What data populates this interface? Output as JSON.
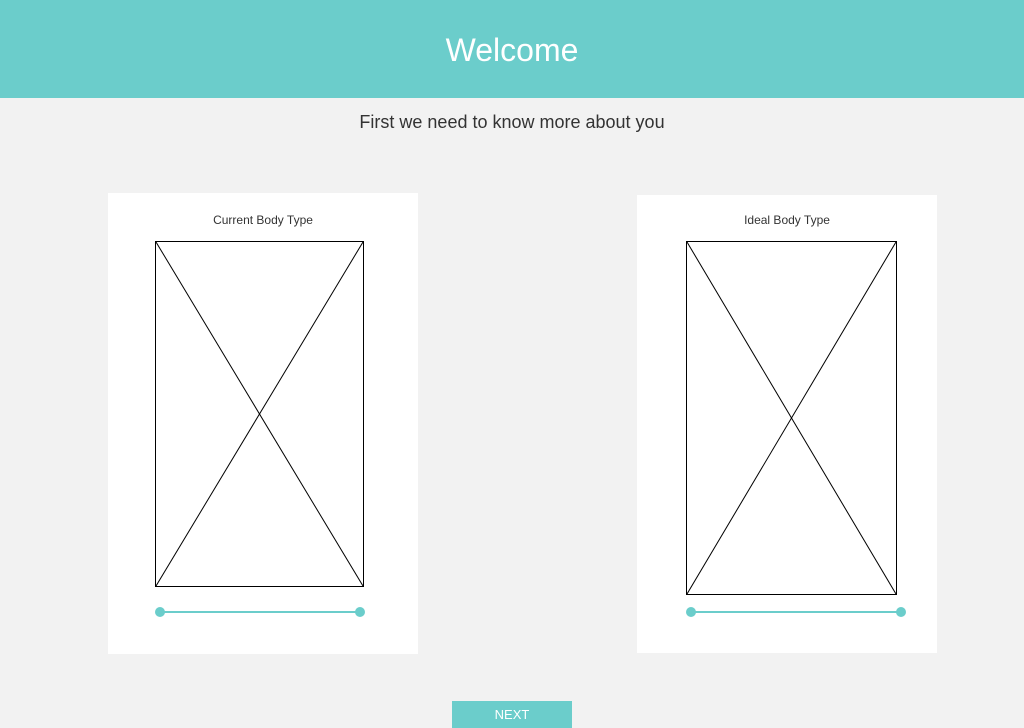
{
  "header": {
    "title": "Welcome"
  },
  "subtitle": "First we need to know more about you",
  "cards": [
    {
      "title": "Current Body Type",
      "image_icon": "image-placeholder-icon",
      "slider": {
        "min": 0,
        "max": 100,
        "range": [
          0,
          100
        ]
      }
    },
    {
      "title": "Ideal Body Type",
      "image_icon": "image-placeholder-icon",
      "slider": {
        "min": 0,
        "max": 100,
        "range": [
          0,
          100
        ]
      }
    }
  ],
  "footer": {
    "next_label": "NEXT"
  },
  "colors": {
    "accent": "#6bcdcb",
    "background": "#f2f2f2",
    "card": "#ffffff",
    "text": "#333333",
    "header_text": "#ffffff"
  }
}
